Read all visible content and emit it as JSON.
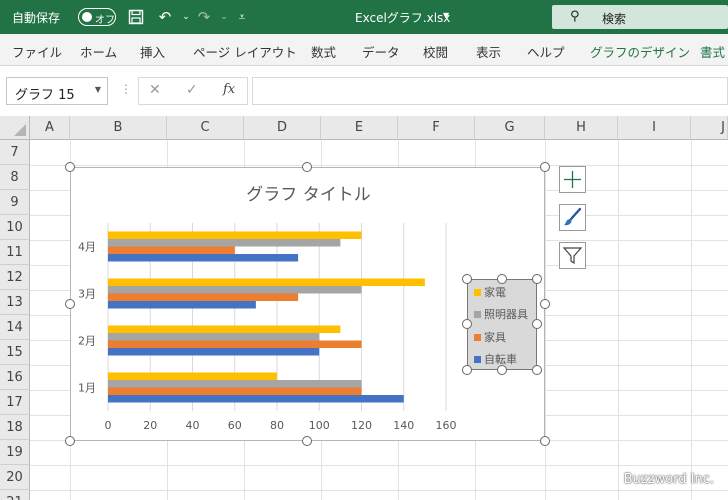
{
  "titlebar": {
    "autosave_label": "自動保存",
    "autosave_state": "オフ",
    "filename": "Excelグラフ.xlsx",
    "search_label": "検索",
    "accent": "#217346"
  },
  "ribbon": {
    "tabs": [
      "ファイル",
      "ホーム",
      "挿入",
      "ページ レイアウト",
      "数式",
      "データ",
      "校閲",
      "表示",
      "ヘルプ",
      "グラフのデザイン",
      "書式"
    ]
  },
  "formula_bar": {
    "name_box": "グラフ 15",
    "fx": "fx",
    "value": ""
  },
  "sheet": {
    "columns": [
      "A",
      "B",
      "C",
      "D",
      "E",
      "F",
      "G",
      "H",
      "I",
      "J"
    ],
    "rows": [
      "7",
      "8",
      "9",
      "10",
      "11",
      "12",
      "13",
      "14",
      "15",
      "16",
      "17",
      "18",
      "19",
      "20",
      "21"
    ]
  },
  "chart_data": {
    "type": "bar",
    "orientation": "horizontal",
    "title": "グラフ タイトル",
    "categories": [
      "1月",
      "2月",
      "3月",
      "4月"
    ],
    "series": [
      {
        "name": "自転車",
        "color": "#4472c4",
        "values": [
          140,
          100,
          70,
          90
        ]
      },
      {
        "name": "家具",
        "color": "#ed7d31",
        "values": [
          120,
          120,
          90,
          60
        ]
      },
      {
        "name": "照明器具",
        "color": "#a5a5a5",
        "values": [
          120,
          100,
          120,
          110
        ]
      },
      {
        "name": "家電",
        "color": "#ffc000",
        "values": [
          80,
          110,
          150,
          120
        ]
      }
    ],
    "xlim": [
      0,
      160
    ],
    "xticks": [
      "0",
      "20",
      "40",
      "60",
      "80",
      "100",
      "120",
      "140",
      "160"
    ],
    "grid": true,
    "legend_position": "right",
    "legend_order": [
      "家電",
      "照明器具",
      "家具",
      "自転車"
    ]
  },
  "watermark": "Buzzword Inc."
}
